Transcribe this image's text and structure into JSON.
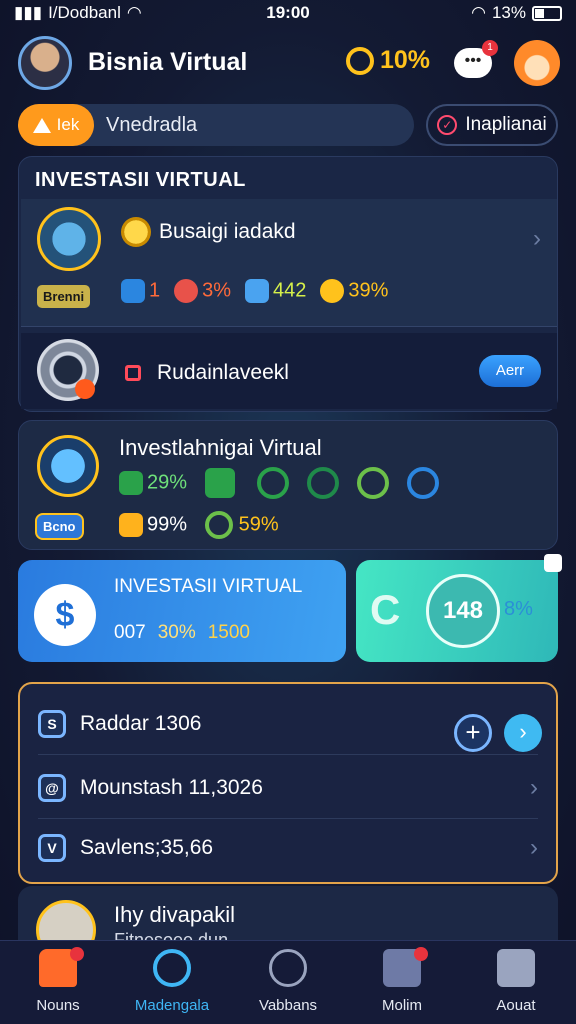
{
  "status_bar": {
    "carrier": "I/Dodbanl",
    "time": "19:00",
    "battery": "13%"
  },
  "header": {
    "title": "Bisnia Virtual",
    "coins": "10%",
    "chat_badge": "1"
  },
  "search": {
    "level_label": "Iek",
    "query": "Vnedradla",
    "filter_label": "Inaplianai"
  },
  "panel1": {
    "section_title": "INVESTASII VIRTUAL",
    "card_a": {
      "title": "Busaigi iadakd",
      "tag": "Brenni",
      "stat1": "1",
      "stat2": "3%",
      "stat3": "442",
      "stat4": "39%"
    },
    "card_b": {
      "title": "Rudainlaveekl",
      "action_label": "Aerr"
    }
  },
  "panel2": {
    "title": "Investlahnigai Virtual",
    "tag": "Bcno",
    "stat1": "29%",
    "stat2": "99%",
    "stat3": "59%"
  },
  "promo_left": {
    "title": "INVESTASII VIRTUAL",
    "stat1": "007",
    "stat2": "30%",
    "stat3": "1500"
  },
  "promo_right": {
    "value": "148",
    "pct": "8%"
  },
  "panel3": {
    "rows": [
      {
        "label": "Raddar 1306",
        "icon": "S"
      },
      {
        "label": "Mounstash 11,3026",
        "icon": "@"
      },
      {
        "label": "Savlens;35,66",
        "icon": "V"
      }
    ]
  },
  "panel4": {
    "title": "Ihy divapakil",
    "subtitle": "Fitnesoee dun"
  },
  "tabbar": {
    "tabs": [
      {
        "label": "Nouns",
        "icon": "home-icon"
      },
      {
        "label": "Madengala",
        "icon": "coin-icon"
      },
      {
        "label": "Vabbans",
        "icon": "close-circle-icon"
      },
      {
        "label": "Molim",
        "icon": "puzzle-icon"
      },
      {
        "label": "Aouat",
        "icon": "settings-icon"
      }
    ]
  }
}
